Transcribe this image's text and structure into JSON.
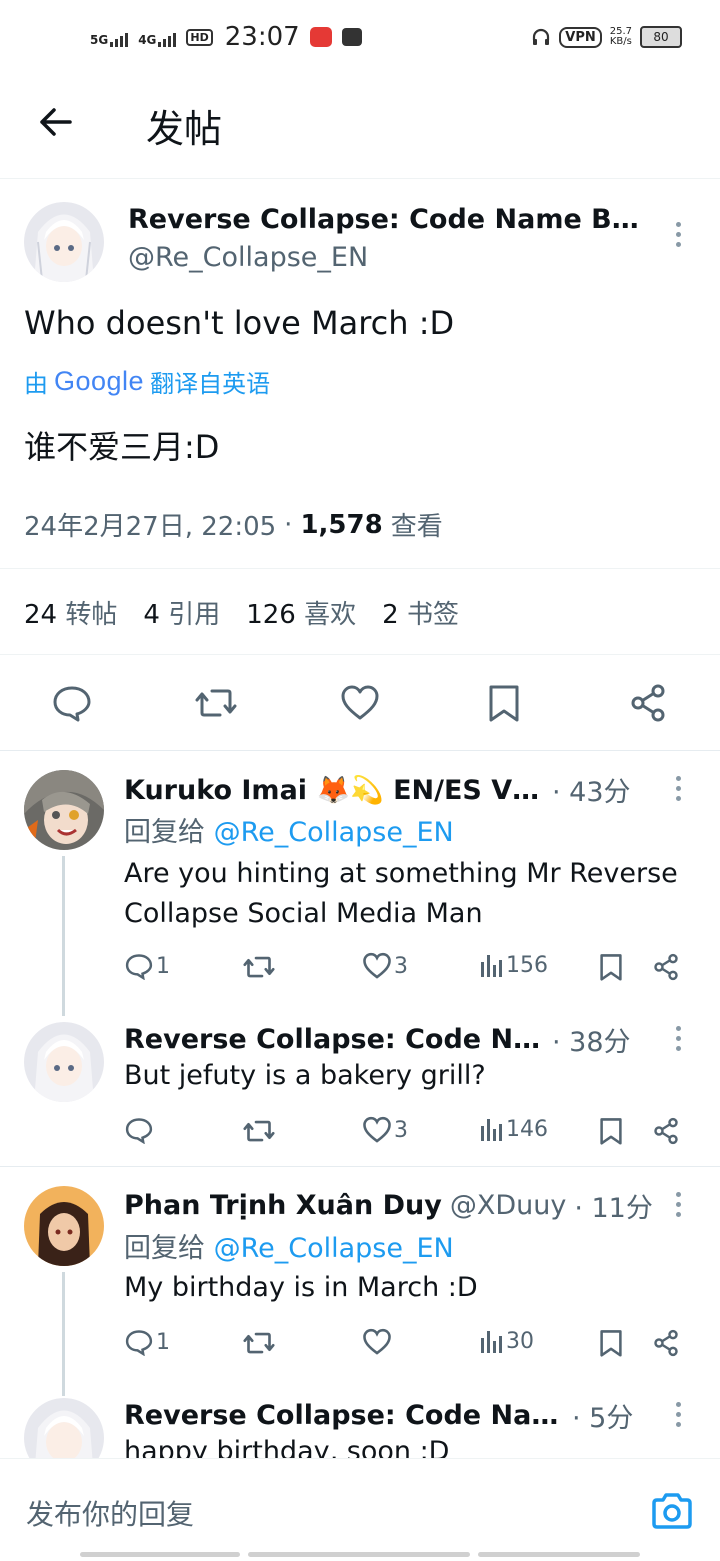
{
  "status_bar": {
    "net1": "5G",
    "net2": "4G",
    "hd": "HD",
    "time": "23:07",
    "vpn": "VPN",
    "speed_value": "25.7",
    "speed_unit": "KB/s",
    "battery": "80"
  },
  "header": {
    "title": "发帖"
  },
  "main_post": {
    "author_name": "Reverse Collapse: Code Name Bak...",
    "author_handle": "@Re_Collapse_EN",
    "text": "Who doesn't love March :D",
    "translation_prefix": "由",
    "translation_brand": "Google",
    "translation_suffix": "翻译自英语",
    "translated_text": "谁不爱三月:D",
    "timestamp": "24年2月27日, 22:05",
    "separator": "·",
    "views_count": "1,578",
    "views_label": "查看",
    "stats": [
      {
        "count": "24",
        "label": "转帖"
      },
      {
        "count": "4",
        "label": "引用"
      },
      {
        "count": "126",
        "label": "喜欢"
      },
      {
        "count": "2",
        "label": "书签"
      }
    ]
  },
  "replies": [
    {
      "name": "Kuruko Imai 🦊💫 EN/ES VT...",
      "time": "· 43分",
      "reply_to_prefix": "回复给",
      "reply_to_handle": "@Re_Collapse_EN",
      "text": "Are you hinting at something Mr Reverse Collapse Social Media Man",
      "replies": "1",
      "reposts": "",
      "likes": "3",
      "views": "156"
    },
    {
      "name": "Reverse Collapse: Code Na...",
      "time": "· 38分",
      "text": "But jefuty is a bakery grill?",
      "replies": "",
      "reposts": "",
      "likes": "3",
      "views": "146"
    },
    {
      "name": "Phan Trịnh Xuân Duy",
      "handle": "@XDuuy",
      "time": "· 11分",
      "reply_to_prefix": "回复给",
      "reply_to_handle": "@Re_Collapse_EN",
      "text": "My birthday is in March :D",
      "replies": "1",
      "reposts": "",
      "likes": "",
      "views": "30"
    },
    {
      "name": "Reverse Collapse: Code Nam...",
      "time": "· 5分",
      "text": "happy birthday, soon :D"
    }
  ],
  "reply_bar": {
    "placeholder": "发布你的回复"
  },
  "colors": {
    "accent": "#1d9bf0",
    "text": "#0f1419",
    "secondary": "#536471"
  }
}
